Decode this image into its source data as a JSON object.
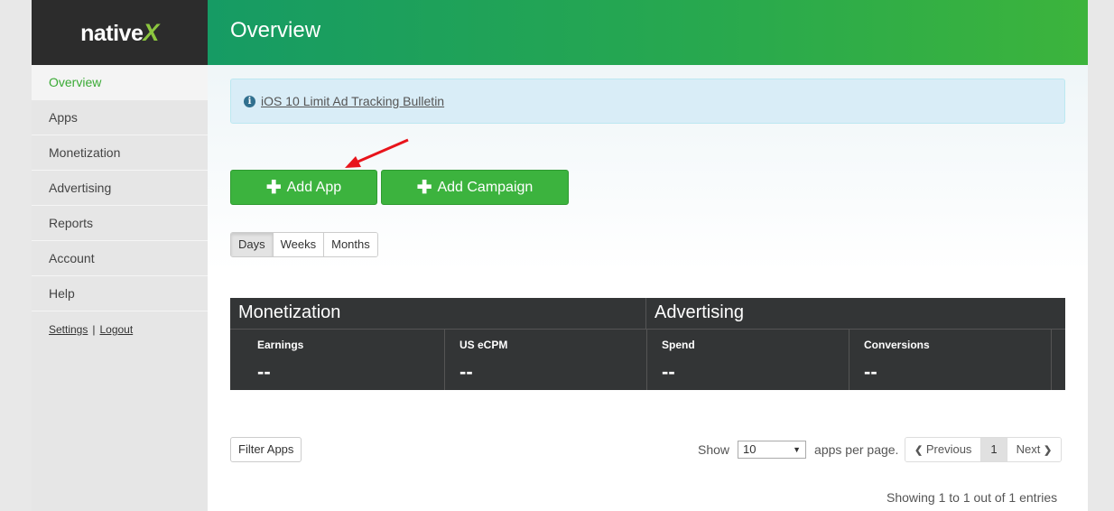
{
  "brand": {
    "name": "native",
    "x": "X"
  },
  "sidebar": {
    "items": [
      {
        "label": "Overview"
      },
      {
        "label": "Apps"
      },
      {
        "label": "Monetization"
      },
      {
        "label": "Advertising"
      },
      {
        "label": "Reports"
      },
      {
        "label": "Account"
      },
      {
        "label": "Help"
      }
    ],
    "settings": "Settings",
    "separator": "|",
    "logout": "Logout"
  },
  "header": {
    "title": "Overview"
  },
  "bulletin": {
    "icon": "info-icon",
    "text": "iOS 10 Limit Ad Tracking Bulletin"
  },
  "actions": {
    "add_app": "Add App",
    "add_campaign": "Add Campaign",
    "plus": "✚"
  },
  "range": {
    "options": [
      "Days",
      "Weeks",
      "Months"
    ],
    "selected": "Days"
  },
  "stats": {
    "monetization": {
      "title": "Monetization",
      "metrics": [
        {
          "label": "Earnings",
          "value": "--"
        },
        {
          "label": "US eCPM",
          "value": "--"
        }
      ]
    },
    "advertising": {
      "title": "Advertising",
      "metrics": [
        {
          "label": "Spend",
          "value": "--"
        },
        {
          "label": "Conversions",
          "value": "--"
        }
      ]
    }
  },
  "table_controls": {
    "filter": "Filter Apps",
    "show": "Show",
    "per_page_value": "10",
    "per_page_suffix": "apps per page.",
    "previous": "Previous",
    "page": "1",
    "next": "Next",
    "entries": "Showing 1 to 1 out of 1 entries"
  },
  "colors": {
    "brand_green": "#3cb33e",
    "header_dark": "#2c2c2c",
    "stats_bg": "#333536",
    "active_nav": "#3aaa35"
  }
}
